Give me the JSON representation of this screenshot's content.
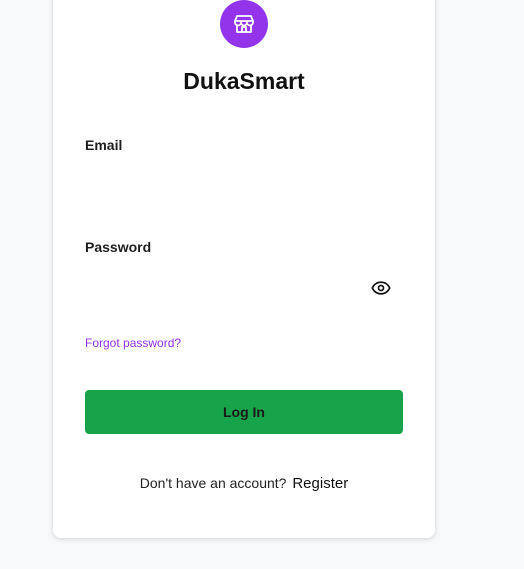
{
  "app": {
    "name": "DukaSmart",
    "logo_icon": "store-icon",
    "brand_color": "#9333ea"
  },
  "form": {
    "email_label": "Email",
    "email_value": "",
    "password_label": "Password",
    "password_value": "",
    "password_toggle_icon": "eye-icon",
    "forgot_password_text": "Forgot password?",
    "login_button_label": "Log In",
    "login_button_color": "#16a34a"
  },
  "footer": {
    "prompt_text": "Don't have an account?",
    "register_link_text": "Register"
  }
}
